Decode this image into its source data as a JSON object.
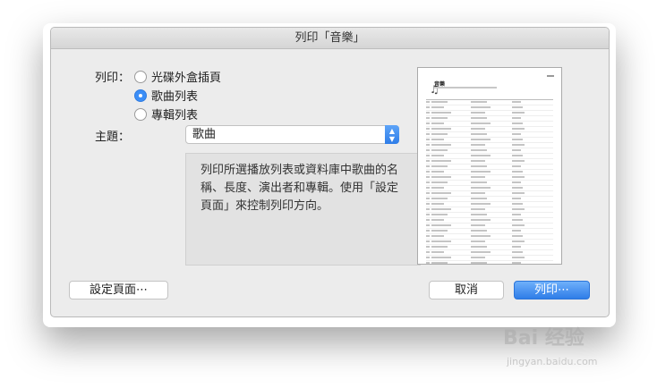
{
  "dialog": {
    "title": "列印「音樂」",
    "print_label": "列印：",
    "options": [
      {
        "label": "光碟外盒插頁",
        "selected": false
      },
      {
        "label": "歌曲列表",
        "selected": true
      },
      {
        "label": "專輯列表",
        "selected": false
      }
    ],
    "theme_label": "主題：",
    "theme_value": "歌曲",
    "description": "列印所選播放列表或資料庫中歌曲的名稱、長度、演出者和專輯。使用「設定頁面」來控制列印方向。",
    "page_setup_button": "設定頁面⋯",
    "cancel_button": "取消",
    "print_button": "列印⋯"
  },
  "preview": {
    "title": "音樂",
    "row_count": 34
  },
  "watermark": {
    "text": "Bai 经验",
    "sub": "jingyan.baidu.com"
  },
  "colors": {
    "accent": "#3b8ef7",
    "dialog_bg": "#ececec"
  }
}
